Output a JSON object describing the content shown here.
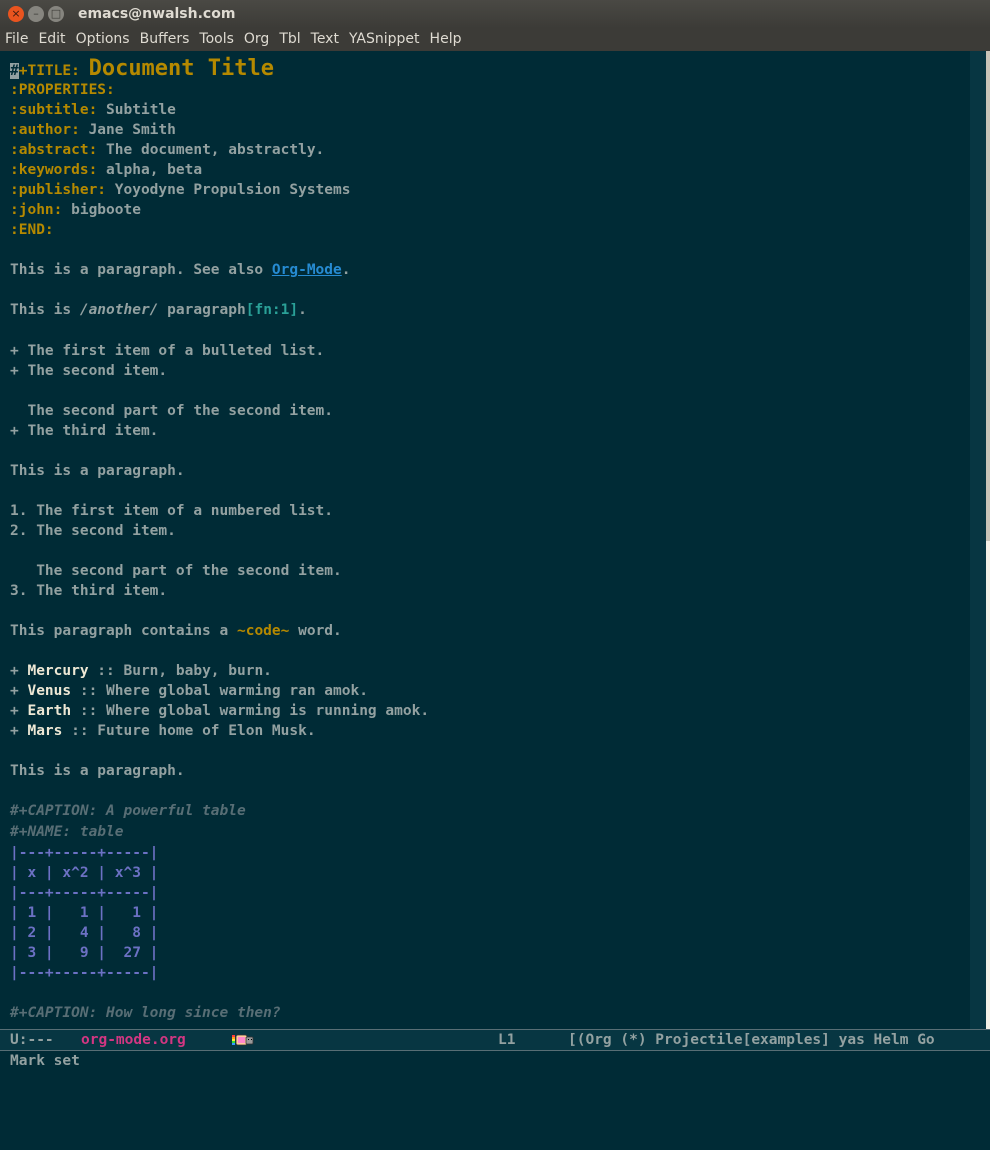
{
  "window": {
    "title": "emacs@nwalsh.com",
    "buttons": {
      "close": "×",
      "minimize": "–",
      "maximize": "□"
    }
  },
  "menubar": [
    "File",
    "Edit",
    "Options",
    "Buffers",
    "Tools",
    "Org",
    "Tbl",
    "Text",
    "YASnippet",
    "Help"
  ],
  "buffer": {
    "title_kw_cursor": "#",
    "title_kw": "+TITLE:",
    "title_val": "Document Title",
    "properties": [
      {
        "key": ":PROPERTIES:",
        "val": ""
      },
      {
        "key": ":subtitle:",
        "val": " Subtitle"
      },
      {
        "key": ":author:",
        "val": " Jane Smith"
      },
      {
        "key": ":abstract:",
        "val": " The document, abstractly."
      },
      {
        "key": ":keywords:",
        "val": " alpha, beta"
      },
      {
        "key": ":publisher:",
        "val": " Yoyodyne Propulsion Systems"
      },
      {
        "key": ":john:",
        "val": " bigboote"
      },
      {
        "key": ":END:",
        "val": ""
      }
    ],
    "para1_pre": "This is a paragraph. See also ",
    "para1_link": "Org-Mode",
    "para1_post": ".",
    "para2_pre": "This is ",
    "para2_italic": "/another/",
    "para2_mid": " paragraph",
    "para2_fn": "[fn:1]",
    "para2_post": ".",
    "bullets": [
      "+ The first item of a bulleted list.",
      "+ The second item.",
      "  The second part of the second item.",
      "+ The third item."
    ],
    "para3": "This is a paragraph.",
    "numbered": [
      "1. The first item of a numbered list.",
      "2. The second item.",
      "   The second part of the second item.",
      "3. The third item."
    ],
    "code_pre": "This paragraph contains a ",
    "code_word": "~code~",
    "code_post": " word.",
    "defs": [
      {
        "term": "Mercury",
        "desc": " :: Burn, baby, burn."
      },
      {
        "term": "Venus",
        "desc": " :: Where global warming ran amok."
      },
      {
        "term": "Earth",
        "desc": " :: Where global warming is running amok."
      },
      {
        "term": "Mars",
        "desc": " :: Future home of Elon Musk."
      }
    ],
    "para4": "This is a paragraph.",
    "caption1": "#+CAPTION: A powerful table",
    "name1": "#+NAME: table",
    "table": [
      "|---+-----+-----|",
      "| x | x^2 | x^3 |",
      "|---+-----+-----|",
      "| 1 |   1 |   1 |",
      "| 2 |   4 |   8 |",
      "| 3 |   9 |  27 |",
      "|---+-----+-----|"
    ],
    "caption2": "#+CAPTION: How long since then?"
  },
  "modeline": {
    "status": "U:---",
    "buffer_name": "org-mode.org",
    "line": "L1",
    "modes": "[(Org (*) Projectile[examples] yas Helm Go"
  },
  "echo": "Mark set"
}
